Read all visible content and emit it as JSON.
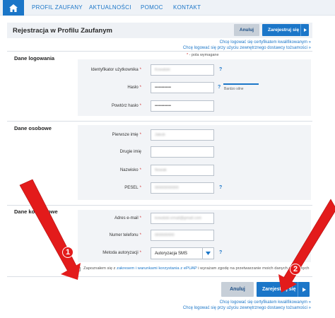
{
  "nav": {
    "items": [
      {
        "label": "PROFIL ZAUFANY"
      },
      {
        "label": "AKTUALNOŚCI"
      },
      {
        "label": "POMOC"
      },
      {
        "label": "KONTAKT"
      }
    ]
  },
  "header": {
    "title": "Rejestracja w Profilu Zaufanym",
    "cancel_label": "Anuluj",
    "register_label": "Zarejestruj się"
  },
  "links": {
    "certificate": "Chcę logować się certyfikatem kwalifikowanym »",
    "external": "Chcę logować się przy użyciu zewnętrznego dostawcy tożsamości »"
  },
  "required_note": {
    "star": "*",
    "text": " - pola wymagane"
  },
  "sections": {
    "login": "Dane logowania",
    "personal": "Dane osobowe",
    "contact": "Dane kontaktowe"
  },
  "fields": {
    "username": {
      "label": "Identyfikator użytkownika",
      "value": "Kowalski"
    },
    "password": {
      "label": "Hasło",
      "value": "••••••••••••"
    },
    "password_confirm": {
      "label": "Powtórz hasło",
      "value": "••••••••••••"
    },
    "first_name": {
      "label": "Pierwsze imię",
      "value": "Jakub"
    },
    "second_name": {
      "label": "Drugie imię",
      "value": ""
    },
    "last_name": {
      "label": "Nazwisko",
      "value": "Nowak"
    },
    "pesel": {
      "label": "PESEL",
      "value": "00000000000"
    },
    "email": {
      "label": "Adres e-mail",
      "value": "kowalski.email@gmail.com"
    },
    "phone": {
      "label": "Numer telefonu",
      "value": "000000000"
    },
    "auth_method": {
      "label": "Metoda autoryzacji",
      "value": "Autoryzacja SMS"
    }
  },
  "required_star": "*",
  "help_glyph": "?",
  "password_strength": {
    "label": "Bardzo silne",
    "level": 1.0
  },
  "consent": {
    "before": "Zapoznałem się z ",
    "link": "zakresem i warunkami korzystania z ePUAP",
    "after": " i wyrażam zgodę na przetwarzanie moich danych osobowych"
  },
  "footer": {
    "cancel_label": "Anuluj",
    "register_label": "Zarejestruj się"
  },
  "annotations": [
    {
      "number": "1"
    },
    {
      "number": "2"
    }
  ],
  "colors": {
    "brand_blue": "#1b76c8",
    "annotation_red": "#e31b1b",
    "required_red": "#d23232"
  },
  "icons": {
    "home": "home-icon",
    "chevron": "chevron-right-icon",
    "dropdown": "chevron-down-icon"
  }
}
